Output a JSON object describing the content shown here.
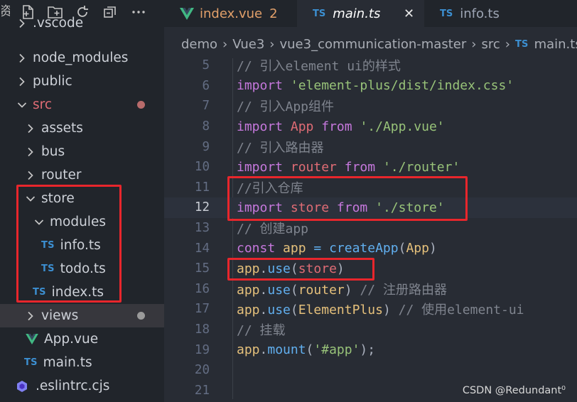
{
  "sidebar": {
    "cut_label": "资",
    "actions": [
      "new-file-icon",
      "new-folder-icon",
      "refresh-icon",
      "collapse-icon",
      "more-icon"
    ],
    "tree": [
      {
        "label": ".vscode",
        "kind": "folder",
        "expanded": false,
        "depth": 1
      },
      {
        "label": "node_modules",
        "kind": "folder",
        "expanded": false,
        "depth": 1
      },
      {
        "label": "public",
        "kind": "folder",
        "expanded": false,
        "depth": 1
      },
      {
        "label": "src",
        "kind": "folder",
        "expanded": true,
        "depth": 1,
        "modified": true
      },
      {
        "label": "assets",
        "kind": "folder",
        "expanded": false,
        "depth": 2
      },
      {
        "label": "bus",
        "kind": "folder",
        "expanded": false,
        "depth": 2
      },
      {
        "label": "router",
        "kind": "folder",
        "expanded": false,
        "depth": 2
      },
      {
        "label": "store",
        "kind": "folder",
        "expanded": true,
        "depth": 2
      },
      {
        "label": "modules",
        "kind": "folder",
        "expanded": true,
        "depth": 3
      },
      {
        "label": "info.ts",
        "kind": "ts",
        "depth": 4
      },
      {
        "label": "todo.ts",
        "kind": "ts",
        "depth": 4
      },
      {
        "label": "index.ts",
        "kind": "ts",
        "depth": 3
      },
      {
        "label": "views",
        "kind": "folder",
        "expanded": false,
        "depth": 2,
        "selected": true,
        "dot": true
      },
      {
        "label": "App.vue",
        "kind": "vue",
        "depth": 2
      },
      {
        "label": "main.ts",
        "kind": "ts",
        "depth": 2
      },
      {
        "label": ".eslintrc.cjs",
        "kind": "eslint",
        "depth": 1
      }
    ],
    "ts_badge": "TS"
  },
  "tabs": [
    {
      "label": "index.vue",
      "badge": "2",
      "icon": "vue-icon",
      "active": false
    },
    {
      "label": "main.ts",
      "icon": "ts-icon",
      "active": true,
      "close": "✕"
    },
    {
      "label": "info.ts",
      "icon": "ts-icon",
      "active": false
    }
  ],
  "breadcrumb": [
    "demo",
    "Vue3",
    "vue3_communication-master",
    "src",
    "main.ts"
  ],
  "breadcrumb_ts": "TS",
  "code": [
    {
      "n": "5",
      "tokens": [
        [
          "c-com",
          "// 引入element ui的样式"
        ]
      ]
    },
    {
      "n": "6",
      "tokens": [
        [
          "c-kw",
          "import"
        ],
        [
          "c-def",
          " "
        ],
        [
          "c-str",
          "'element-plus/dist/index.css'"
        ]
      ]
    },
    {
      "n": "7",
      "tokens": [
        [
          "c-com",
          "// 引入App组件"
        ]
      ]
    },
    {
      "n": "8",
      "tokens": [
        [
          "c-kw",
          "import"
        ],
        [
          "c-def",
          " "
        ],
        [
          "c-var",
          "App"
        ],
        [
          "c-def",
          " "
        ],
        [
          "c-kw",
          "from"
        ],
        [
          "c-def",
          " "
        ],
        [
          "c-str",
          "'./App.vue'"
        ]
      ]
    },
    {
      "n": "9",
      "tokens": [
        [
          "c-com",
          "// 引入路由器"
        ]
      ]
    },
    {
      "n": "10",
      "tokens": [
        [
          "c-kw",
          "import"
        ],
        [
          "c-def",
          " "
        ],
        [
          "c-var",
          "router"
        ],
        [
          "c-def",
          " "
        ],
        [
          "c-kw",
          "from"
        ],
        [
          "c-def",
          " "
        ],
        [
          "c-str",
          "'./router'"
        ]
      ]
    },
    {
      "n": "11",
      "tokens": [
        [
          "c-com",
          "//引入仓库"
        ]
      ]
    },
    {
      "n": "12",
      "current": true,
      "tokens": [
        [
          "c-kw",
          "import"
        ],
        [
          "c-def",
          " "
        ],
        [
          "c-var",
          "store"
        ],
        [
          "c-def",
          " "
        ],
        [
          "c-kw",
          "from"
        ],
        [
          "c-def",
          " "
        ],
        [
          "c-str",
          "'./store'"
        ]
      ]
    },
    {
      "n": "13",
      "tokens": [
        [
          "c-com",
          "// 创建app"
        ]
      ]
    },
    {
      "n": "14",
      "tokens": [
        [
          "c-kw",
          "const"
        ],
        [
          "c-def",
          " "
        ],
        [
          "c-cls",
          "app"
        ],
        [
          "c-def",
          " "
        ],
        [
          "c-fn",
          "="
        ],
        [
          "c-def",
          " "
        ],
        [
          "c-fn",
          "createApp"
        ],
        [
          "c-def",
          "("
        ],
        [
          "c-cls",
          "App"
        ],
        [
          "c-def",
          ")"
        ]
      ]
    },
    {
      "n": "15",
      "tokens": [
        [
          "c-cls",
          "app"
        ],
        [
          "c-def",
          "."
        ],
        [
          "c-fn",
          "use"
        ],
        [
          "c-def",
          "("
        ],
        [
          "c-var",
          "store"
        ],
        [
          "c-def",
          ")"
        ]
      ]
    },
    {
      "n": "16",
      "tokens": [
        [
          "c-cls",
          "app"
        ],
        [
          "c-def",
          "."
        ],
        [
          "c-fn",
          "use"
        ],
        [
          "c-def",
          "("
        ],
        [
          "c-cls",
          "router"
        ],
        [
          "c-def",
          ") "
        ],
        [
          "c-com",
          "// 注册路由器"
        ]
      ]
    },
    {
      "n": "17",
      "tokens": [
        [
          "c-cls",
          "app"
        ],
        [
          "c-def",
          "."
        ],
        [
          "c-fn",
          "use"
        ],
        [
          "c-def",
          "("
        ],
        [
          "c-cls",
          "ElementPlus"
        ],
        [
          "c-def",
          ") "
        ],
        [
          "c-com",
          "// 使用element-ui"
        ]
      ]
    },
    {
      "n": "18",
      "tokens": [
        [
          "c-com",
          "// 挂载"
        ]
      ]
    },
    {
      "n": "19",
      "tokens": [
        [
          "c-cls",
          "app"
        ],
        [
          "c-def",
          "."
        ],
        [
          "c-fn",
          "mount"
        ],
        [
          "c-def",
          "("
        ],
        [
          "c-str",
          "'#app'"
        ],
        [
          "c-def",
          ");"
        ]
      ]
    },
    {
      "n": "20",
      "tokens": []
    },
    {
      "n": "21",
      "tokens": []
    }
  ],
  "watermark": "CSDN @Redundant⁰",
  "colors": {
    "highlight_box": "#e8262c",
    "modified_dot": "#b86b6b",
    "ts_badge": "#3c8fd1",
    "vue_green": "#41b883",
    "tab_modified": "#e2a06a"
  }
}
